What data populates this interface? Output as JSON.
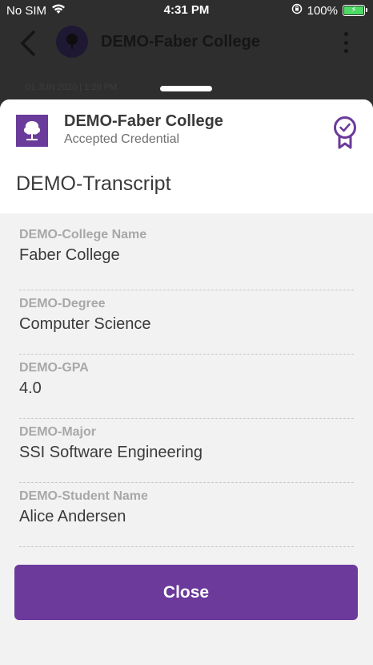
{
  "status_bar": {
    "carrier": "No SIM",
    "time": "4:31 PM",
    "battery_pct": "100%"
  },
  "background_app": {
    "title": "DEMO-Faber College",
    "date": "01 JUN 2020 | 1:29 PM"
  },
  "sheet": {
    "issuer_name": "DEMO-Faber College",
    "issuer_status": "Accepted Credential",
    "credential_title": "DEMO-Transcript",
    "fields": [
      {
        "label": "DEMO-College Name",
        "value": "Faber College"
      },
      {
        "label": "DEMO-Degree",
        "value": "Computer Science"
      },
      {
        "label": "DEMO-GPA",
        "value": "4.0"
      },
      {
        "label": "DEMO-Major",
        "value": "SSI Software Engineering"
      },
      {
        "label": "DEMO-Student Name",
        "value": "Alice Andersen"
      }
    ],
    "close_label": "Close"
  },
  "icons": {
    "wifi": "wifi-icon",
    "lock_rotation": "orientation-lock-icon",
    "battery": "battery-charging-icon",
    "back": "chevron-left-icon",
    "tree": "tree-logo-icon",
    "more": "kebab-menu-icon",
    "badge": "award-ribbon-icon"
  },
  "colors": {
    "accent": "#6b3a9b",
    "battery": "#4cd964"
  }
}
